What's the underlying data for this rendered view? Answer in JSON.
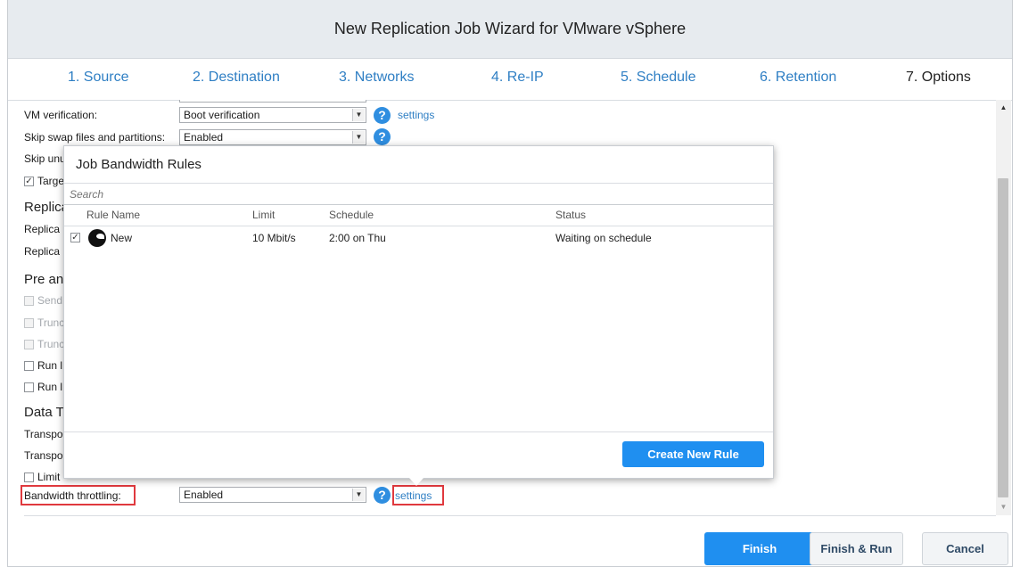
{
  "window": {
    "title": "New Replication Job Wizard for VMware vSphere"
  },
  "steps": [
    {
      "label": "1. Source"
    },
    {
      "label": "2. Destination"
    },
    {
      "label": "3. Networks"
    },
    {
      "label": "4. Re-IP"
    },
    {
      "label": "5. Schedule"
    },
    {
      "label": "6. Retention"
    },
    {
      "label": "7. Options"
    }
  ],
  "options": {
    "vm_verification": {
      "label": "VM verification:",
      "value": "Boot verification",
      "link": "settings"
    },
    "skip_swap": {
      "label": "Skip swap files and partitions:",
      "value": "Enabled"
    },
    "skip_unused": {
      "label": "Skip unu"
    },
    "target_check": {
      "label": "Targe"
    },
    "replica_section": {
      "label": "Replica"
    },
    "replica_row1": {
      "label": "Replica"
    },
    "replica_row2": {
      "label": "Replica"
    },
    "pre_section": {
      "label": "Pre an"
    },
    "send_check": {
      "label": "Send"
    },
    "trunc1_check": {
      "label": "Trunc"
    },
    "trunc2_check": {
      "label": "Trunc"
    },
    "run1_check": {
      "label": "Run l"
    },
    "run2_check": {
      "label": "Run l"
    },
    "data_section": {
      "label": "Data T"
    },
    "transpo1": {
      "label": "Transpo"
    },
    "transpo2": {
      "label": "Transpo"
    },
    "limit_check": {
      "label": "Limit"
    },
    "bandwidth": {
      "label": "Bandwidth throttling:",
      "value": "Enabled",
      "link": "settings"
    }
  },
  "popup": {
    "title": "Job Bandwidth Rules",
    "search_placeholder": "Search",
    "columns": {
      "name": "Rule Name",
      "limit": "Limit",
      "schedule": "Schedule",
      "status": "Status"
    },
    "rows": [
      {
        "name": "New",
        "limit": "10 Mbit/s",
        "schedule": "2:00 on Thu",
        "status": "Waiting on schedule",
        "checked": true
      }
    ],
    "create_button": "Create New Rule"
  },
  "footer": {
    "finish": "Finish",
    "finish_run": "Finish & Run",
    "cancel": "Cancel"
  },
  "colors": {
    "accent": "#1f8ff0",
    "link": "#2f7fc4",
    "highlight": "#e0393e"
  }
}
